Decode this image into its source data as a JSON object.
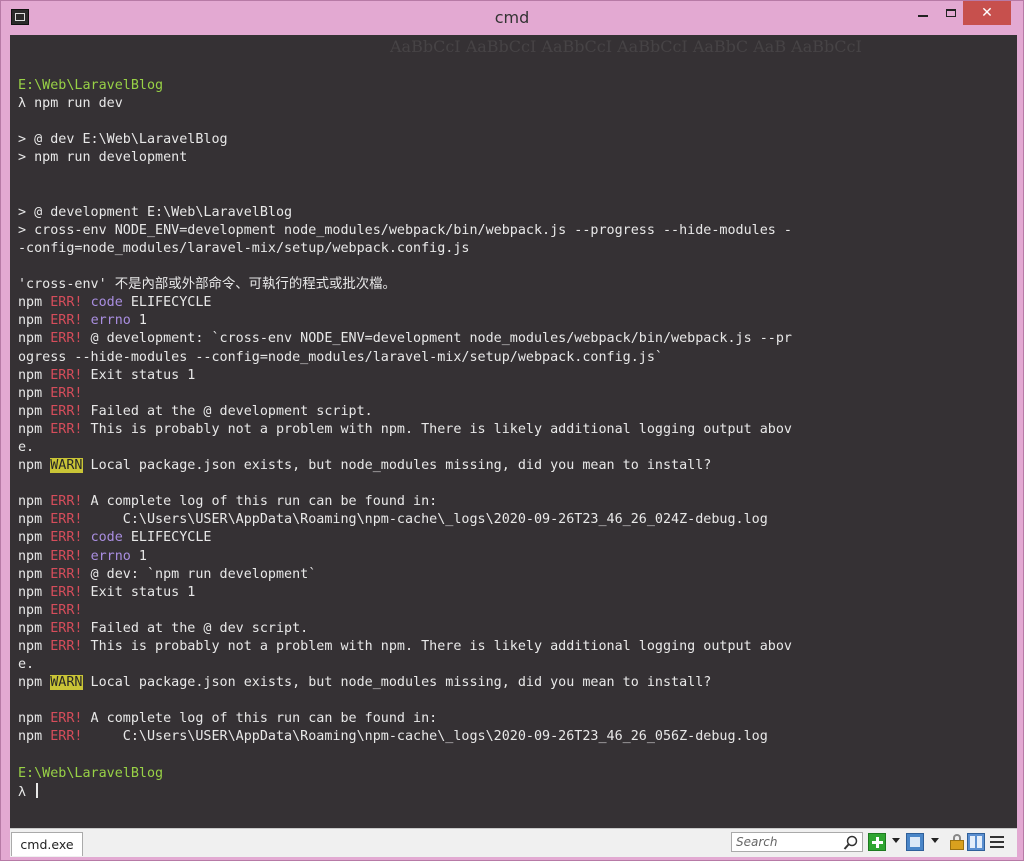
{
  "window": {
    "title": "cmd",
    "minimize_label": "",
    "maximize_label": "",
    "close_label": "✕"
  },
  "terminal": {
    "lines": [
      [],
      [
        {
          "t": "E:\\Web\\LaravelBlog",
          "c": "path"
        }
      ],
      [
        {
          "t": "λ npm run dev"
        }
      ],
      [],
      [
        {
          "t": "> @ dev E:\\Web\\LaravelBlog"
        }
      ],
      [
        {
          "t": "> npm run development"
        }
      ],
      [],
      [],
      [
        {
          "t": "> @ development E:\\Web\\LaravelBlog"
        }
      ],
      [
        {
          "t": "> cross-env NODE_ENV=development node_modules/webpack/bin/webpack.js --progress --hide-modules -"
        }
      ],
      [
        {
          "t": "-config=node_modules/laravel-mix/setup/webpack.config.js"
        }
      ],
      [],
      [
        {
          "t": "'cross-env' 不是內部或外部命令、可執行的程式或批次檔。"
        }
      ],
      [
        {
          "t": "npm "
        },
        {
          "t": "ERR!",
          "c": "err"
        },
        {
          "t": " "
        },
        {
          "t": "code",
          "c": "kw"
        },
        {
          "t": " ELIFECYCLE"
        }
      ],
      [
        {
          "t": "npm "
        },
        {
          "t": "ERR!",
          "c": "err"
        },
        {
          "t": " "
        },
        {
          "t": "errno",
          "c": "kw"
        },
        {
          "t": " 1"
        }
      ],
      [
        {
          "t": "npm "
        },
        {
          "t": "ERR!",
          "c": "err"
        },
        {
          "t": " @ development: `cross-env NODE_ENV=development node_modules/webpack/bin/webpack.js --pr"
        }
      ],
      [
        {
          "t": "ogress --hide-modules --config=node_modules/laravel-mix/setup/webpack.config.js`"
        }
      ],
      [
        {
          "t": "npm "
        },
        {
          "t": "ERR!",
          "c": "err"
        },
        {
          "t": " Exit status 1"
        }
      ],
      [
        {
          "t": "npm "
        },
        {
          "t": "ERR!",
          "c": "err"
        }
      ],
      [
        {
          "t": "npm "
        },
        {
          "t": "ERR!",
          "c": "err"
        },
        {
          "t": " Failed at the @ development script."
        }
      ],
      [
        {
          "t": "npm "
        },
        {
          "t": "ERR!",
          "c": "err"
        },
        {
          "t": " This is probably not a problem with npm. There is likely additional logging output abov"
        }
      ],
      [
        {
          "t": "e."
        }
      ],
      [
        {
          "t": "npm "
        },
        {
          "t": "WARN",
          "c": "warn"
        },
        {
          "t": " Local package.json exists, but node_modules missing, did you mean to install?"
        }
      ],
      [],
      [
        {
          "t": "npm "
        },
        {
          "t": "ERR!",
          "c": "err"
        },
        {
          "t": " A complete log of this run can be found in:"
        }
      ],
      [
        {
          "t": "npm "
        },
        {
          "t": "ERR!",
          "c": "err"
        },
        {
          "t": "     C:\\Users\\USER\\AppData\\Roaming\\npm-cache\\_logs\\2020-09-26T23_46_26_024Z-debug.log"
        }
      ],
      [
        {
          "t": "npm "
        },
        {
          "t": "ERR!",
          "c": "err"
        },
        {
          "t": " "
        },
        {
          "t": "code",
          "c": "kw"
        },
        {
          "t": " ELIFECYCLE"
        }
      ],
      [
        {
          "t": "npm "
        },
        {
          "t": "ERR!",
          "c": "err"
        },
        {
          "t": " "
        },
        {
          "t": "errno",
          "c": "kw"
        },
        {
          "t": " 1"
        }
      ],
      [
        {
          "t": "npm "
        },
        {
          "t": "ERR!",
          "c": "err"
        },
        {
          "t": " @ dev: `npm run development`"
        }
      ],
      [
        {
          "t": "npm "
        },
        {
          "t": "ERR!",
          "c": "err"
        },
        {
          "t": " Exit status 1"
        }
      ],
      [
        {
          "t": "npm "
        },
        {
          "t": "ERR!",
          "c": "err"
        }
      ],
      [
        {
          "t": "npm "
        },
        {
          "t": "ERR!",
          "c": "err"
        },
        {
          "t": " Failed at the @ dev script."
        }
      ],
      [
        {
          "t": "npm "
        },
        {
          "t": "ERR!",
          "c": "err"
        },
        {
          "t": " This is probably not a problem with npm. There is likely additional logging output abov"
        }
      ],
      [
        {
          "t": "e."
        }
      ],
      [
        {
          "t": "npm "
        },
        {
          "t": "WARN",
          "c": "warn"
        },
        {
          "t": " Local package.json exists, but node_modules missing, did you mean to install?"
        }
      ],
      [],
      [
        {
          "t": "npm "
        },
        {
          "t": "ERR!",
          "c": "err"
        },
        {
          "t": " A complete log of this run can be found in:"
        }
      ],
      [
        {
          "t": "npm "
        },
        {
          "t": "ERR!",
          "c": "err"
        },
        {
          "t": "     C:\\Users\\USER\\AppData\\Roaming\\npm-cache\\_logs\\2020-09-26T23_46_26_056Z-debug.log"
        }
      ],
      [],
      [
        {
          "t": "E:\\Web\\LaravelBlog",
          "c": "path"
        }
      ],
      [
        {
          "t": "λ "
        }
      ]
    ]
  },
  "statusbar": {
    "tab_label": "cmd.exe",
    "search_placeholder": "Search"
  },
  "icons": [
    "app-icon",
    "search-icon",
    "new-console-icon",
    "view-icon",
    "lock-icon",
    "split-icon",
    "menu-icon"
  ],
  "colors": {
    "path": "#98d146",
    "error": "#d64d5b",
    "keyword": "#a98ee0",
    "warn_bg": "#c9c436",
    "close_button": "#c7504d",
    "frame": "#e3a9d2"
  }
}
